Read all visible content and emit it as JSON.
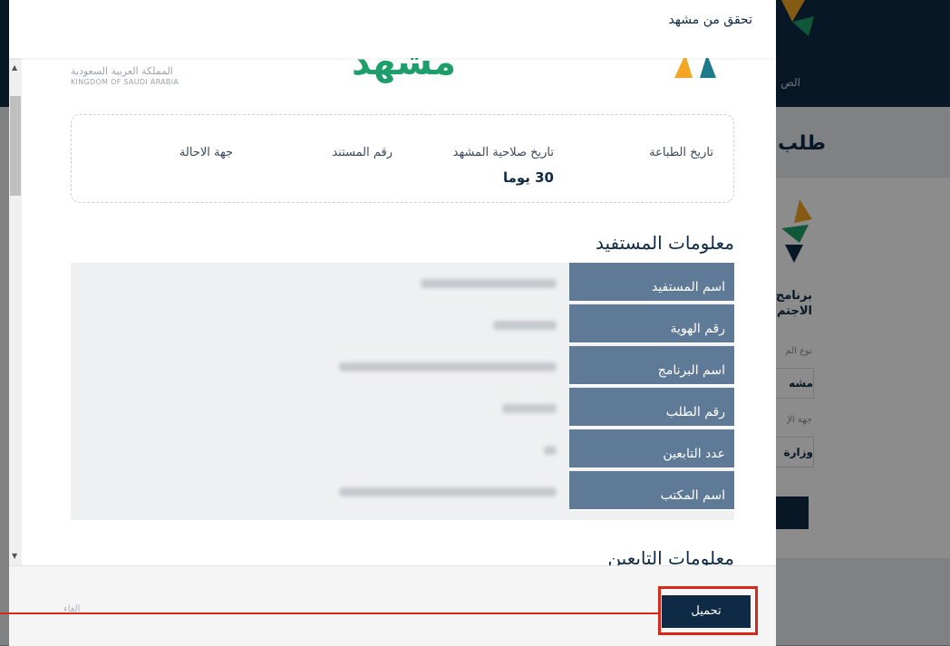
{
  "background": {
    "nav_item": "الص",
    "page_title": "طلب",
    "program_name": "برنامج الاجتم",
    "field1_label": "نوع الم",
    "field1_value": "مشه",
    "field2_label": "جهة الإ",
    "field2_value": "وزارة"
  },
  "modal": {
    "title": "تحقق من مشهد",
    "gov_name_ar": "المملكة العربية السعودية",
    "gov_name_en": "KINGDOM OF SAUDI ARABIA",
    "doc_logo_text": "مشهد",
    "info": {
      "print_date_label": "تاريخ الطباعة",
      "validity_label": "تاريخ صلاحية المشهد",
      "validity_value": "30 يوما",
      "doc_number_label": "رقم المستند",
      "referral_label": "جهة الاحالة"
    },
    "beneficiary_section_title": "معلومات المستفيد",
    "beneficiary_rows": [
      {
        "label": "اسم المستفيد"
      },
      {
        "label": "رقم الهوية"
      },
      {
        "label": "اسم البرنامج"
      },
      {
        "label": "رقم الطلب"
      },
      {
        "label": "عدد التابعين"
      },
      {
        "label": "اسم المكتب"
      }
    ],
    "dependents_section_title": "معلومات التابعين",
    "cancel_label": "إلغاء",
    "download_label": "تحميل"
  },
  "colors": {
    "primary": "#0e2a44",
    "table_label_bg": "#5e7a96",
    "highlight_red": "#d7281a",
    "logo_green": "#1e9e6a"
  }
}
